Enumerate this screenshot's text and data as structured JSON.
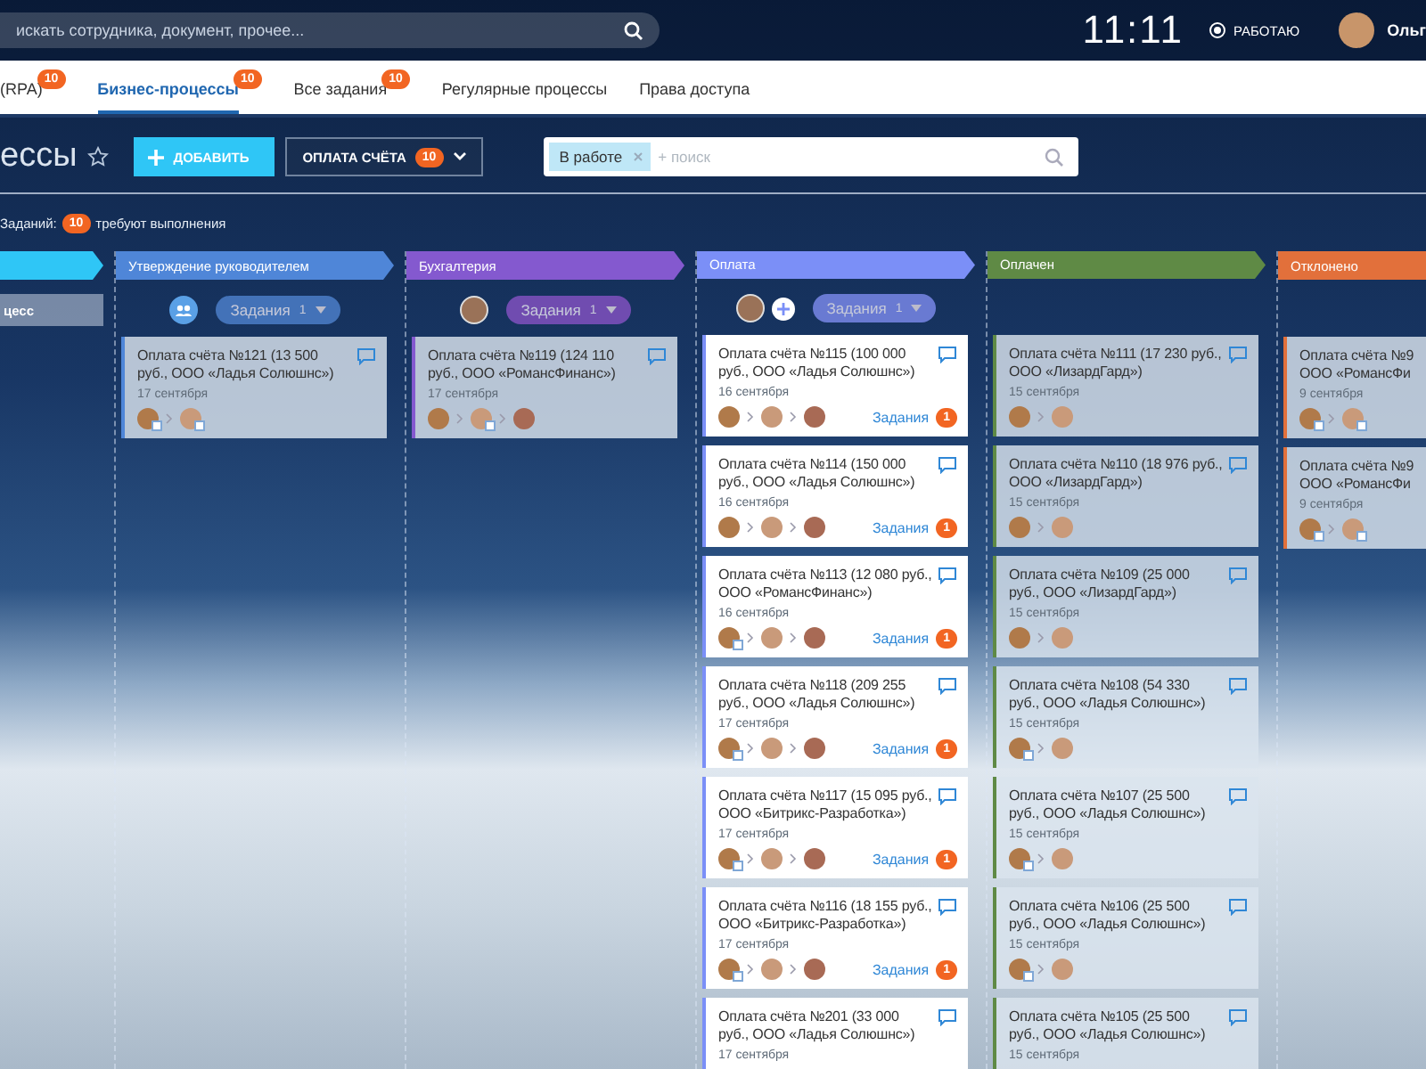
{
  "topbar": {
    "search_placeholder": "искать сотрудника, документ, прочее...",
    "clock": "11:11",
    "status": "РАБОТАЮ",
    "user_name": "Ольг"
  },
  "tabs": [
    {
      "label": "(RPA)",
      "badge": "10",
      "selected": false
    },
    {
      "label": "Бизнес-процессы",
      "badge": "10",
      "selected": true
    },
    {
      "label": "Все задания",
      "badge": "10",
      "selected": false
    },
    {
      "label": "Регулярные процессы",
      "selected": false
    },
    {
      "label": "Права доступа",
      "selected": false
    }
  ],
  "toolbar": {
    "title": "ессы",
    "add_button": "ДОБАВИТЬ",
    "process_button": {
      "label": "ОПЛАТА СЧЁТА",
      "badge": "10"
    },
    "filter": {
      "chip": "В работе",
      "placeholder": "+ поиск"
    }
  },
  "counter": {
    "label": "Заданий:",
    "badge": "10",
    "text": "требуют выполнения"
  },
  "columns": [
    {
      "color": "#2fc6f6",
      "add_process": "цесс"
    },
    {
      "title": "Утверждение руководителем",
      "color": "#4f86d8",
      "comments": true,
      "avatars": [
        {
          "kind": "group"
        }
      ],
      "tasks": {
        "label": "Задания",
        "count": "1"
      },
      "cards": [
        {
          "title": "Оплата счёта №121 (13 500 руб., ООО «Ладья Солюшнс»)",
          "date": "17 сентября",
          "avatars": [
            {
              "badge": true
            },
            {
              "badge": true
            }
          ]
        }
      ]
    },
    {
      "title": "Бухгалтерия",
      "color": "#8459cf",
      "comments": true,
      "avatars": [
        {
          "kind": "person"
        }
      ],
      "tasks": {
        "label": "Задания",
        "count": "1"
      },
      "cards": [
        {
          "title": "Оплата счёта №119 (124 110 руб., ООО «РомансФинанс»)",
          "date": "17 сентября",
          "avatars": [
            {
              "badge": false
            },
            {
              "badge": true
            },
            {
              "badge": false
            }
          ]
        }
      ]
    },
    {
      "title": "Оплата",
      "color": "#7b8ff7",
      "highlighted": true,
      "comments": true,
      "avatars": [
        {
          "kind": "person"
        }
      ],
      "add_user": true,
      "tasks": {
        "label": "Задания",
        "count": "1"
      },
      "cards": [
        {
          "title": "Оплата счёта №115 (100 000 руб., ООО «Ладья Солюшнс»)",
          "date": "16 сентября",
          "avatars": [
            {
              "badge": false
            },
            {
              "badge": false
            },
            {
              "badge": false
            }
          ],
          "tasks": {
            "label": "Задания",
            "count": "1"
          }
        },
        {
          "title": "Оплата счёта №114 (150 000 руб., ООО «Ладья Солюшнс»)",
          "date": "16 сентября",
          "avatars": [
            {
              "badge": false
            },
            {
              "badge": false
            },
            {
              "badge": false
            }
          ],
          "tasks": {
            "label": "Задания",
            "count": "1"
          }
        },
        {
          "title": "Оплата счёта №113 (12 080 руб., ООО «РомансФинанс»)",
          "date": "16 сентября",
          "avatars": [
            {
              "badge": true
            },
            {
              "badge": false
            },
            {
              "badge": false
            }
          ],
          "tasks": {
            "label": "Задания",
            "count": "1"
          }
        },
        {
          "title": "Оплата счёта №118 (209 255 руб., ООО «Ладья Солюшнс»)",
          "date": "17 сентября",
          "avatars": [
            {
              "badge": true
            },
            {
              "badge": false
            },
            {
              "badge": false
            }
          ],
          "tasks": {
            "label": "Задания",
            "count": "1"
          }
        },
        {
          "title": "Оплата счёта №117 (15 095 руб., ООО «Битрикс-Разработка»)",
          "date": "17 сентября",
          "avatars": [
            {
              "badge": true
            },
            {
              "badge": false
            },
            {
              "badge": false
            }
          ],
          "tasks": {
            "label": "Задания",
            "count": "1"
          }
        },
        {
          "title": "Оплата счёта №116 (18  155 руб., ООО «Битрикс-Разработка»)",
          "date": "17 сентября",
          "avatars": [
            {
              "badge": true
            },
            {
              "badge": false
            },
            {
              "badge": false
            }
          ],
          "tasks": {
            "label": "Задания",
            "count": "1"
          }
        },
        {
          "title": "Оплата счёта №201 (33 000 руб., ООО «Ладья Солюшнс»)",
          "date": "17 сентября"
        }
      ]
    },
    {
      "title": "Оплачен",
      "color": "#5f8a45",
      "comments": true,
      "cards": [
        {
          "title": "Оплата счёта №111 (17 230 руб., ООО «ЛизардГард»)",
          "date": "15 сентября",
          "avatars": [
            {
              "badge": false
            },
            {
              "badge": false
            }
          ]
        },
        {
          "title": "Оплата счёта №110 (18 976 руб., ООО «ЛизардГард»)",
          "date": "15 сентября",
          "avatars": [
            {
              "badge": false
            },
            {
              "badge": false
            }
          ]
        },
        {
          "title": "Оплата счёта №109 (25 000 руб., ООО «ЛизардГард»)",
          "date": "15 сентября",
          "avatars": [
            {
              "badge": false
            },
            {
              "badge": false
            }
          ]
        },
        {
          "title": "Оплата счёта №108 (54 330 руб., ООО «Ладья Солюшнс»)",
          "date": "15 сентября",
          "avatars": [
            {
              "badge": true
            },
            {
              "badge": false
            }
          ]
        },
        {
          "title": "Оплата счёта №107 (25 500 руб., ООО «Ладья Солюшнс»)",
          "date": "15 сентября",
          "avatars": [
            {
              "badge": true
            },
            {
              "badge": false
            }
          ]
        },
        {
          "title": "Оплата счёта №106 (25 500 руб., ООО «Ладья Солюшнс»)",
          "date": "15 сентября",
          "avatars": [
            {
              "badge": true
            },
            {
              "badge": false
            }
          ]
        },
        {
          "title": "Оплата счёта №105 (25 500 руб., ООО «Ладья Солюшнс»)",
          "date": "15 сентября"
        }
      ]
    },
    {
      "title": "Отклонено",
      "color": "#e2703b",
      "comments": false,
      "cards": [
        {
          "title": "Оплата счёта №9 ООО «РомансФи",
          "date": "9 сентября",
          "avatars": [
            {
              "badge": true
            },
            {
              "badge": true
            }
          ]
        },
        {
          "title": "Оплата счёта №9 ООО «РомансФи",
          "date": "9 сентября",
          "avatars": [
            {
              "badge": true
            },
            {
              "badge": true
            }
          ]
        }
      ]
    }
  ]
}
